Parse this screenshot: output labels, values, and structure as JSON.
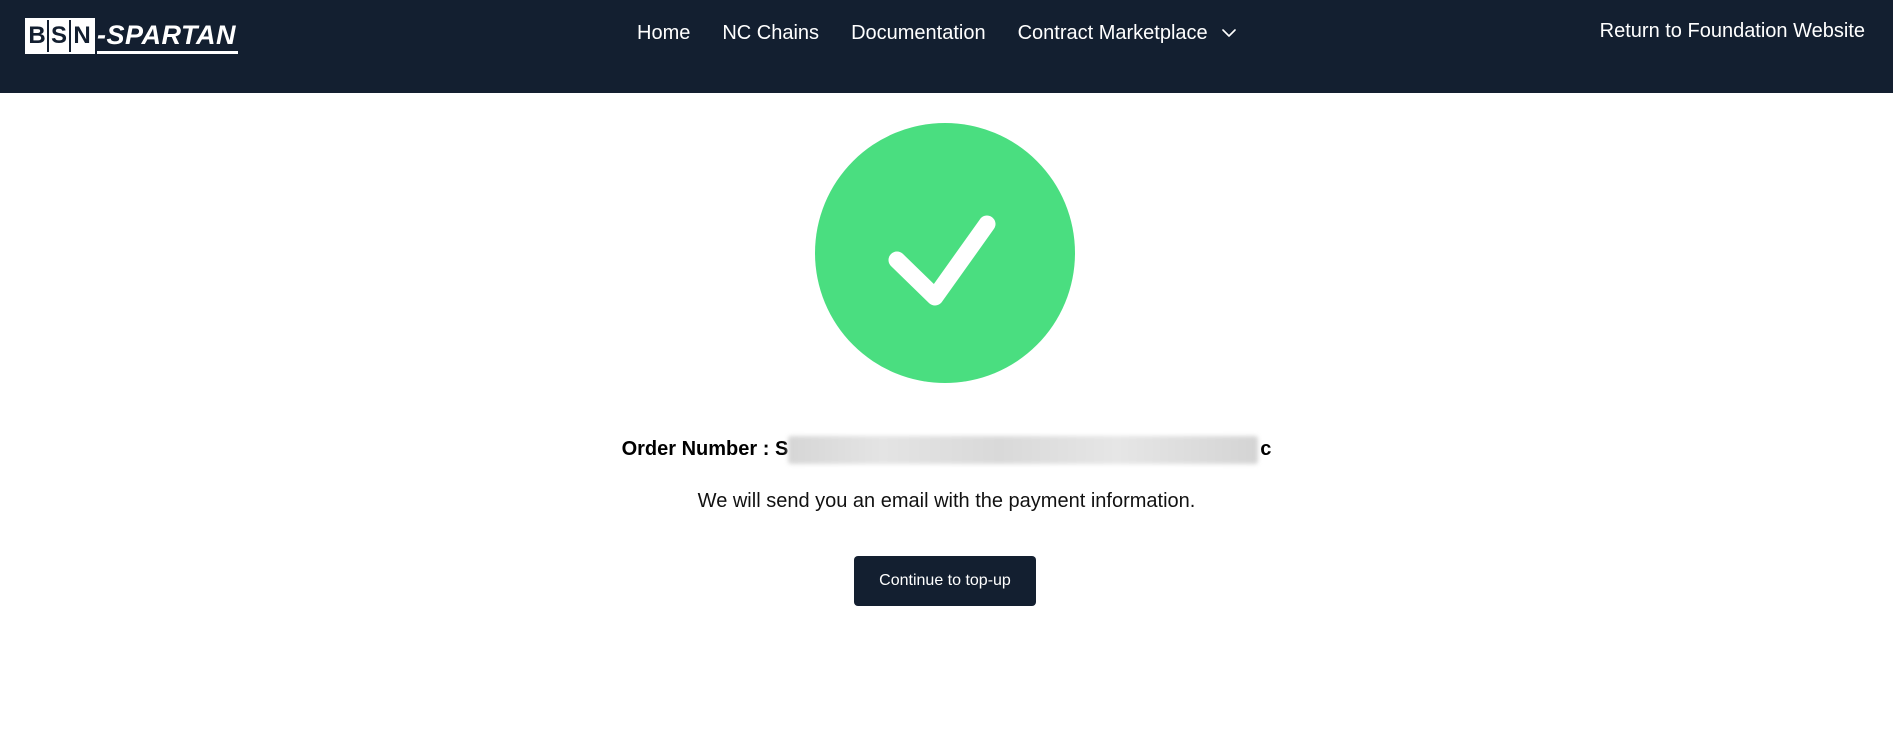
{
  "brand": {
    "letters": [
      "B",
      "S",
      "N"
    ],
    "suffix": "-SPARTAN"
  },
  "nav": {
    "items": [
      {
        "label": "Home"
      },
      {
        "label": "NC Chains"
      },
      {
        "label": "Documentation"
      },
      {
        "label": "Contract Marketplace",
        "has_dropdown": true
      }
    ],
    "return_link": "Return to Foundation Website"
  },
  "status": {
    "icon": "check-circle-icon",
    "color": "#4ade80"
  },
  "order": {
    "label": "Order Number : ",
    "value_visible_start": "S",
    "value_visible_end": "c",
    "value_redacted": true
  },
  "message": "We will send you an email with the payment information.",
  "actions": {
    "continue_label": "Continue to top-up"
  },
  "colors": {
    "header_bg": "#131f30",
    "success_green": "#4ade80",
    "button_bg": "#131f30"
  }
}
